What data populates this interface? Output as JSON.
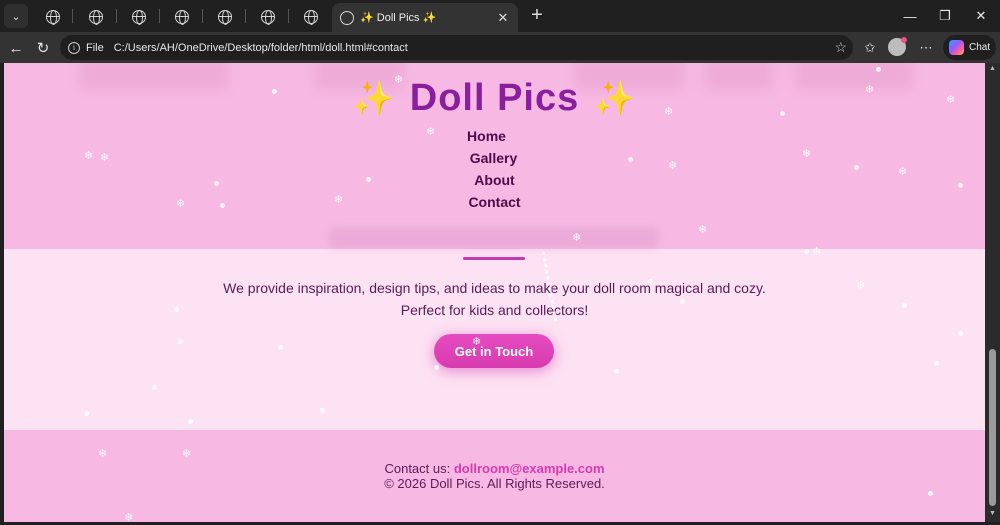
{
  "browser": {
    "tab_title": "✨ Doll Pics ✨",
    "address_scheme": "File",
    "url": "C:/Users/AH/OneDrive/Desktop/folder/html/doll.html#contact",
    "chat_label": "Chat"
  },
  "page": {
    "title": "Doll Pics",
    "sparkle": "✨",
    "nav": [
      "Home",
      "Gallery",
      "About",
      "Contact"
    ],
    "about_line1": "We provide inspiration, design tips, and ideas to make your doll room magical and cozy.",
    "about_line2": "Perfect for kids and collectors!",
    "cta_label": "Get in Touch",
    "footer_contact_label": "Contact us:",
    "footer_email": "dollroom@example.com",
    "footer_copyright": "© 2026 Doll Pics. All Rights Reserved."
  },
  "colors": {
    "header_bg": "#f7b9e3",
    "section_bg": "#fde2f3",
    "title": "#8a1f9e",
    "accent": "#d63bb0",
    "text": "#5a1a59"
  }
}
